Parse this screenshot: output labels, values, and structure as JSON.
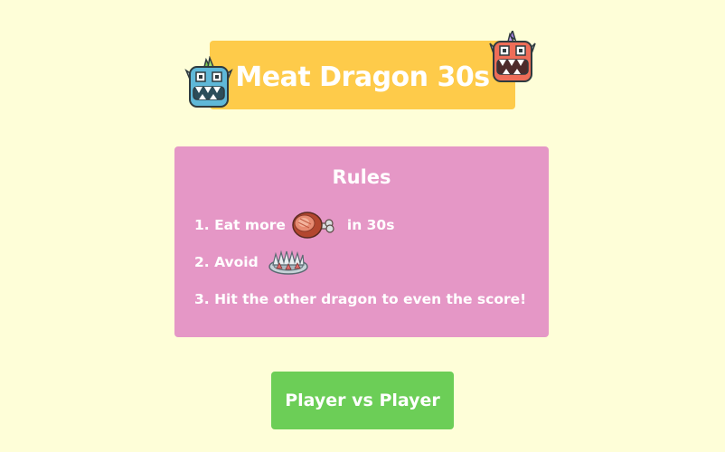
{
  "title": "Meat Dragon 30s",
  "rules": {
    "heading": "Rules",
    "rule1_prefix": "1. Eat more",
    "rule1_suffix": "in 30s",
    "rule2_prefix": "2. Avoid",
    "rule3": "3. Hit the other dragon to even the score!"
  },
  "buttons": {
    "play_label": "Player vs Player"
  },
  "icons": {
    "left_dragon": "blue-dragon-icon",
    "right_dragon": "red-dragon-icon",
    "meat": "meat-icon",
    "trap": "spike-trap-icon"
  },
  "colors": {
    "background": "#fefed8",
    "title_banner": "#fecb4a",
    "rules_box": "#e597c6",
    "play_button": "#6cce57",
    "text": "#ffffff"
  }
}
